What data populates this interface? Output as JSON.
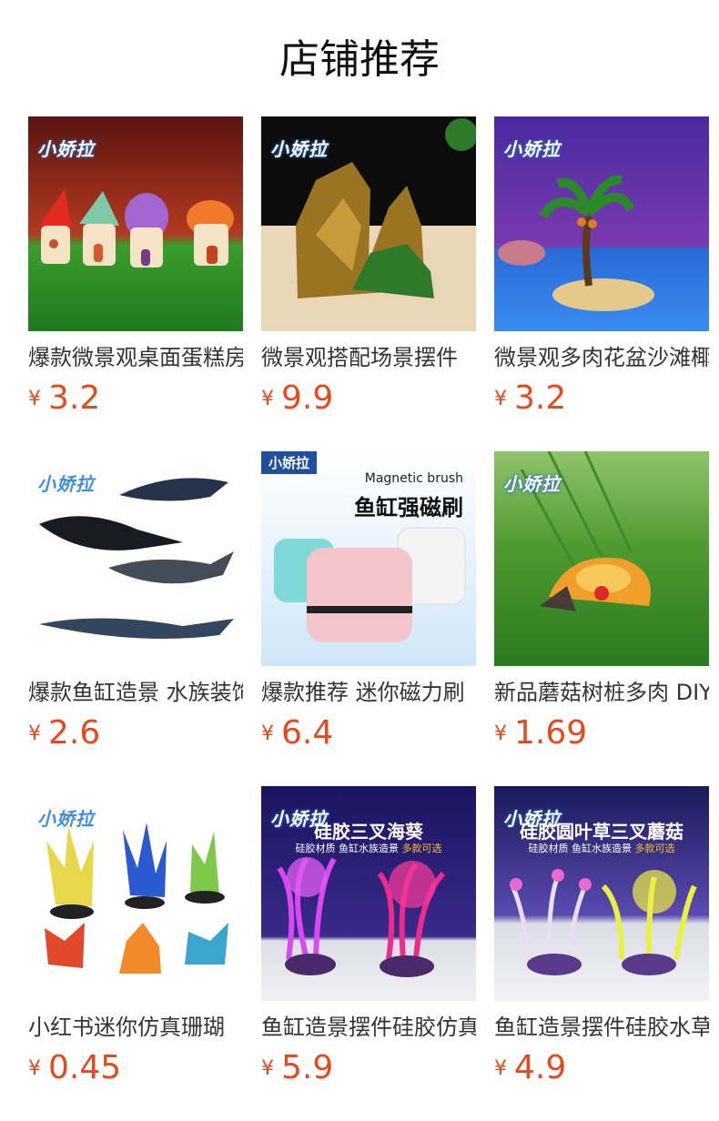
{
  "header": {
    "title": "店铺推荐"
  },
  "products": [
    {
      "name": "爆款微景观桌面蛋糕房子",
      "currency": "¥",
      "price": "3.2",
      "logo": "小娇拉"
    },
    {
      "name": "微景观搭配场景摆件",
      "currency": "¥",
      "price": "9.9",
      "logo": "小娇拉"
    },
    {
      "name": "微景观多肉花盆沙滩椰树",
      "currency": "¥",
      "price": "3.2",
      "logo": "小娇拉"
    },
    {
      "name": "爆款鱼缸造景 水族装饰",
      "currency": "¥",
      "price": "2.6",
      "logo": "小娇拉"
    },
    {
      "name": "爆款推荐 迷你磁力刷",
      "currency": "¥",
      "price": "6.4",
      "logo": "小娇拉",
      "banner_en": "Magnetic brush",
      "banner_cn": "鱼缸强磁刷"
    },
    {
      "name": "新品蘑菇树桩多肉 DIY",
      "currency": "¥",
      "price": "1.69",
      "logo": "小娇拉"
    },
    {
      "name": "小红书迷你仿真珊瑚",
      "currency": "¥",
      "price": "0.45",
      "logo": "小娇拉"
    },
    {
      "name": "鱼缸造景摆件硅胶仿真",
      "currency": "¥",
      "price": "5.9",
      "logo": "小娇拉",
      "banner_title": "硅胶三叉海葵",
      "banner_sub": "硅胶材质 鱼缸水族造景",
      "banner_hl": "多款可选"
    },
    {
      "name": "鱼缸造景摆件硅胶水草",
      "currency": "¥",
      "price": "4.9",
      "logo": "小娇拉",
      "banner_title": "硅胶圆叶草三叉蘑菇",
      "banner_sub": "硅胶材质 鱼缸水族造景",
      "banner_hl": "多款可选"
    }
  ]
}
